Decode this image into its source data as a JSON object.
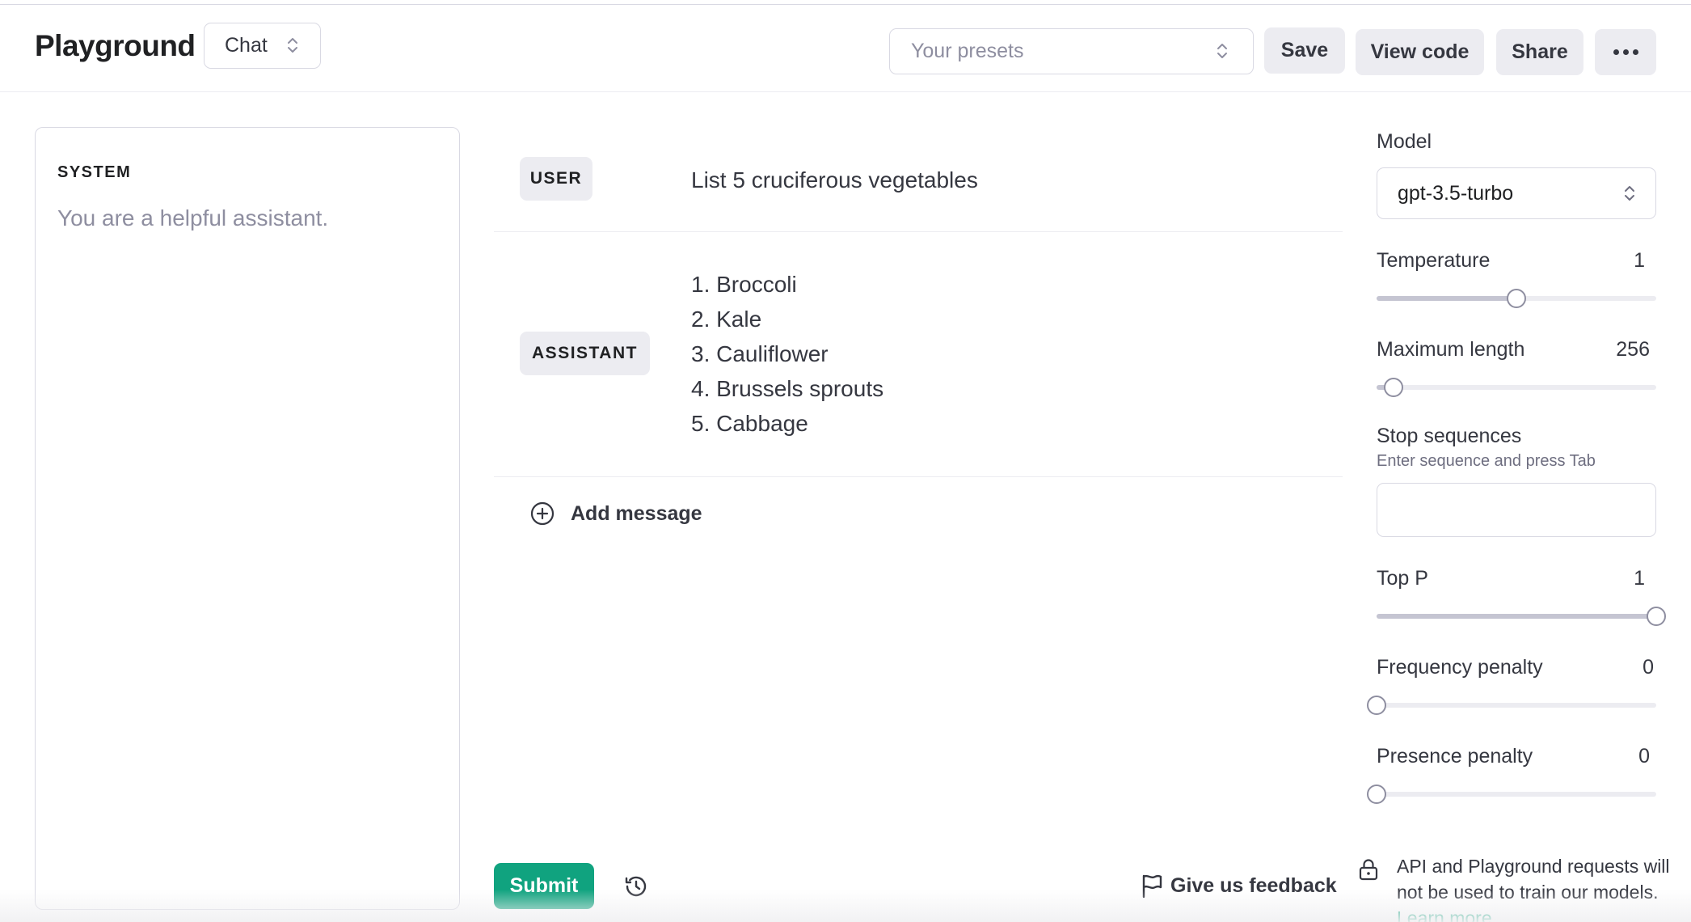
{
  "header": {
    "title": "Playground",
    "mode": "Chat",
    "presets_placeholder": "Your presets",
    "save_label": "Save",
    "view_code_label": "View code",
    "share_label": "Share"
  },
  "system": {
    "label": "SYSTEM",
    "placeholder": "You are a helpful assistant."
  },
  "messages": [
    {
      "role": "USER",
      "text": "List 5 cruciferous vegetables"
    },
    {
      "role": "ASSISTANT",
      "items": [
        "1. Broccoli",
        "2. Kale",
        "3. Cauliflower",
        "4. Brussels sprouts",
        "5. Cabbage"
      ]
    }
  ],
  "add_message_label": "Add message",
  "footer": {
    "submit_label": "Submit",
    "feedback_label": "Give us feedback"
  },
  "settings": {
    "model_label": "Model",
    "model_value": "gpt-3.5-turbo",
    "temperature": {
      "label": "Temperature",
      "value": "1",
      "fraction": 0.5
    },
    "max_length": {
      "label": "Maximum length",
      "value": "256",
      "fraction": 0.06
    },
    "stop_sequences": {
      "label": "Stop sequences",
      "help": "Enter sequence and press Tab"
    },
    "top_p": {
      "label": "Top P",
      "value": "1",
      "fraction": 1.0
    },
    "frequency_penalty": {
      "label": "Frequency penalty",
      "value": "0",
      "fraction": 0.0
    },
    "presence_penalty": {
      "label": "Presence penalty",
      "value": "0",
      "fraction": 0.0
    }
  },
  "notice": {
    "text": "API and Playground requests will not be used to train our models.",
    "link": "Learn more"
  },
  "colors": {
    "accent": "#10a37f",
    "badge_bg": "#ececf1",
    "border": "#d9d9e3"
  }
}
